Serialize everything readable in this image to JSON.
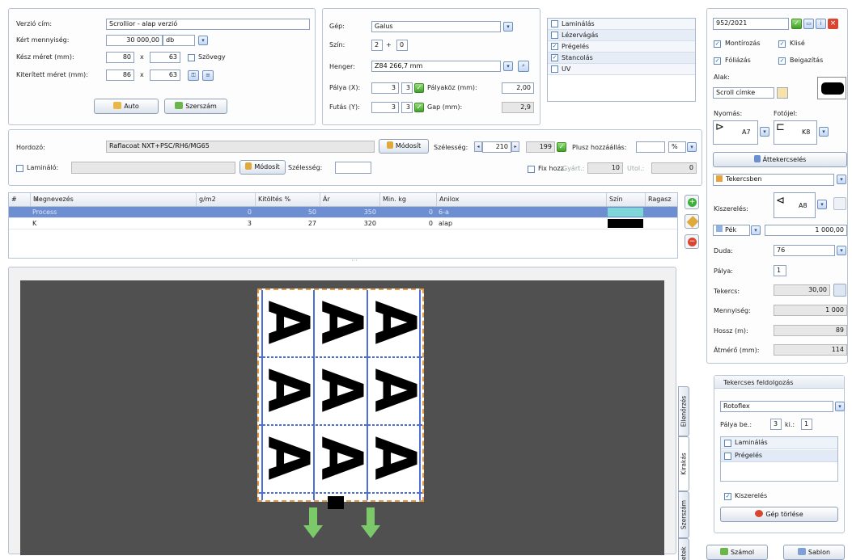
{
  "panel_top_left": {
    "verzio_label": "Verzió cím:",
    "verzio_value": "Scrollior - alap verzió",
    "kert_label": "Kért mennyiség:",
    "kert_value": "30 000,00",
    "kert_unit": "db",
    "kesz_label": "Kész méret (mm):",
    "kesz_w": "80",
    "kesz_x": "x",
    "kesz_h": "63",
    "szoveg": "Szövegy",
    "kiter_label": "Kiterített méret (mm):",
    "kiter_w": "86",
    "kiter_x": "x",
    "kiter_h": "63",
    "auto": "Auto",
    "szerszam": "Szerszám"
  },
  "panel_top_mid": {
    "gep_label": "Gép:",
    "gep_value": "Galus",
    "szin_label": "Szín:",
    "szin_a": "2",
    "plus": "+",
    "szin_b": "0",
    "henger_label": "Henger:",
    "henger_value": "Z84 266,7 mm",
    "palya_label": "Pálya (X):",
    "palya_value": "3",
    "palya_b": "3",
    "palyakoz_label": "Pályaköz (mm):",
    "palyakoz_value": "2,00",
    "futas_label": "Futás (Y):",
    "futas_value": "3",
    "futas_b": "3",
    "gap_label": "Gap (mm):",
    "gap_value": "2,9"
  },
  "ops": [
    {
      "label": "Laminálás",
      "checked": false
    },
    {
      "label": "Lézervágás",
      "checked": false
    },
    {
      "label": "Prégelés",
      "checked": true
    },
    {
      "label": "Stancolás",
      "checked": true
    },
    {
      "label": "UV",
      "checked": false
    }
  ],
  "hordozo": {
    "label": "Hordozó:",
    "value": "Raflacoat NXT+PSC/RH6/MG65",
    "modosit": "Módosít",
    "szelesseg_label": "Szélesség:",
    "szelesseg_value": "210",
    "value2": "199",
    "plusz_label": "Plusz hozzáállás:",
    "pct": "%",
    "lamin_label": "Lamináló:",
    "modosit2": "Módosít",
    "szelesseg2_label": "Szélesség:",
    "fix_label": "Fix hozz.",
    "gyart_label": "Gyárt.:",
    "gyart_value": "10",
    "utol_label": "Utol.:",
    "utol_value": "0"
  },
  "grid": {
    "headers": [
      "#",
      "Megnevezés",
      "g/m2",
      "Kitöltés %",
      "Ár",
      "Min. kg",
      "Anilox",
      "Szín",
      "Ragasz"
    ],
    "rows": [
      {
        "hash": "",
        "name": "Process",
        "gm2": "0",
        "kit": "50",
        "ar": "350",
        "min": "0",
        "anilox": "6-a",
        "color": "#7fd6d8",
        "selected": true
      },
      {
        "hash": "",
        "name": "K",
        "gm2": "3",
        "kit": "27",
        "ar": "320",
        "min": "0",
        "anilox": "alap",
        "color": "#000000",
        "selected": false
      }
    ]
  },
  "vtabs": [
    "Ellenőrzés",
    "Kirakás",
    "Szerszám",
    "Műveletek"
  ],
  "right": {
    "order": "952/2021",
    "montirozas": "Montírozás",
    "klise": "Klisé",
    "fadlas": "Fóliázás",
    "beigazitas": "Beigazítás",
    "alak_label": "Alak:",
    "alak_value": "Scroll címke",
    "nyomas_label": "Nyomás:",
    "nyomas_code": "A7",
    "fotojel_label": "Fotójel:",
    "fotojel_code": "K8",
    "attekercs": "Áttekercselés",
    "tekercs": "Tekercsben",
    "kiszereles_label": "Kiszerelés:",
    "kiszereles_code": "A8",
    "pek_label": "Pék",
    "pek_value": "1 000,00",
    "duda_label": "Duda:",
    "duda_value": "76",
    "palya_label": "Pálya:",
    "palya_value": "1",
    "tekercs_label": "Tekercs:",
    "tekercs_value": "30,00",
    "menny_label": "Mennyiség:",
    "menny_value": "1 000",
    "hossz_label": "Hossz (m):",
    "hossz_value": "89",
    "atm_label": "Átmérő (mm):",
    "atm_value": "114",
    "feldolg_title": "Tekercses feldolgozás",
    "feldolg_value": "Rotoflex",
    "palyabe_label": "Pálya be.:",
    "palyabe_value": "3",
    "ki_label": "ki.:",
    "ki_value": "1",
    "f_lamin": "Laminálás",
    "f_preg": "Prégelés",
    "f_kisz": "Kiszerelés",
    "gep_torles": "Gép törlése",
    "szamol": "Számol",
    "sablon": "Sablon"
  },
  "preview": {
    "glyph": "A",
    "center_grip": "···"
  }
}
